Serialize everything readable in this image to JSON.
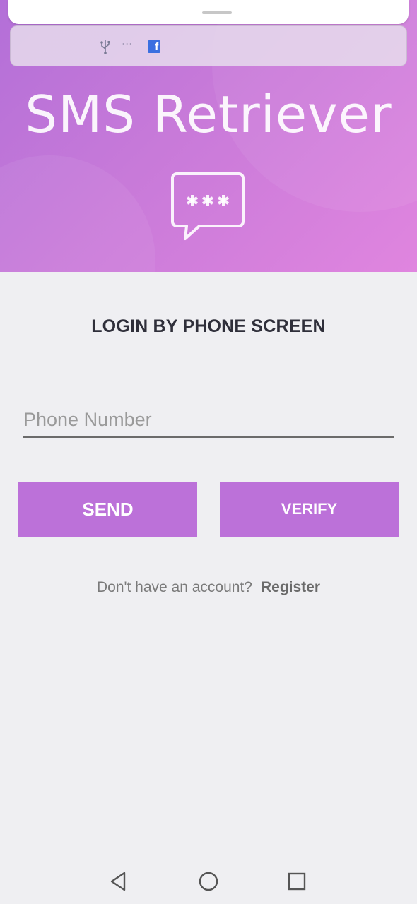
{
  "app": {
    "title": "SMS Retriever"
  },
  "status_bar": {
    "icons": [
      "usb-icon",
      "more-dots-icon",
      "facebook-icon"
    ],
    "dots": "···",
    "fb_letter": "f"
  },
  "login": {
    "screen_title": "LOGIN BY PHONE SCREEN",
    "phone_placeholder": "Phone Number",
    "phone_value": "",
    "send_label": "SEND",
    "verify_label": "VERIFY",
    "no_account_text": "Don't have an account?",
    "register_label": "Register"
  },
  "colors": {
    "accent": "#bc71d9",
    "header_gradient": [
      "#b36fd8",
      "#e085df"
    ],
    "background": "#efeff2"
  },
  "navbar": {
    "buttons": [
      "back-icon",
      "home-icon",
      "recent-apps-icon"
    ]
  }
}
